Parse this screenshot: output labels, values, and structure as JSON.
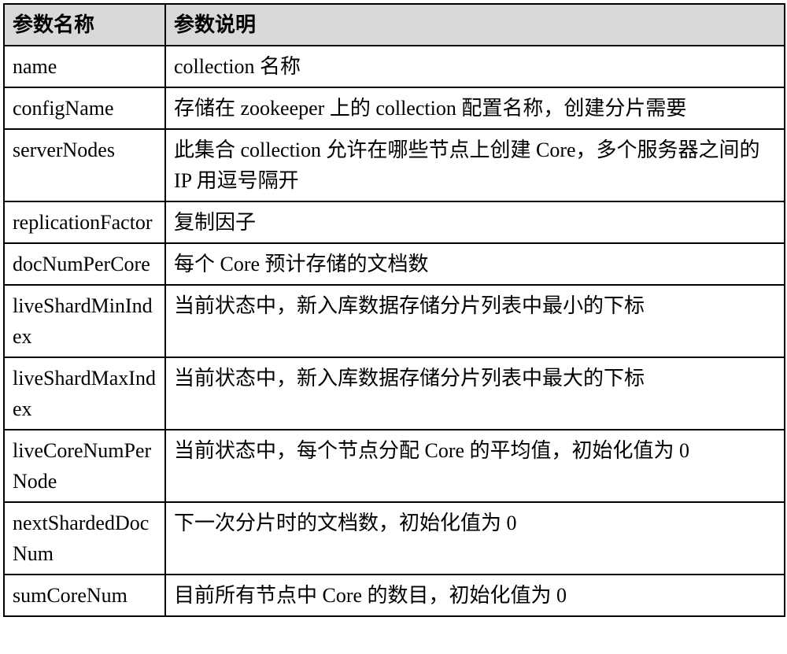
{
  "table": {
    "header": {
      "col1": "参数名称",
      "col2": "参数说明"
    },
    "rows": [
      {
        "name": "name",
        "desc": "collection 名称"
      },
      {
        "name": "configName",
        "desc": "存储在 zookeeper 上的 collection 配置名称，创建分片需要"
      },
      {
        "name": "serverNodes",
        "desc": "此集合 collection 允许在哪些节点上创建 Core，多个服务器之间的 IP 用逗号隔开"
      },
      {
        "name": "replicationFactor",
        "desc": "复制因子"
      },
      {
        "name": "docNumPerCore",
        "desc": "每个 Core 预计存储的文档数"
      },
      {
        "name": "liveShardMinIndex",
        "desc": "当前状态中，新入库数据存储分片列表中最小的下标"
      },
      {
        "name": "liveShardMaxIndex",
        "desc": "当前状态中，新入库数据存储分片列表中最大的下标"
      },
      {
        "name": "liveCoreNumPerNode",
        "desc": "当前状态中，每个节点分配 Core 的平均值，初始化值为 0"
      },
      {
        "name": "nextShardedDocNum",
        "desc": "下一次分片时的文档数，初始化值为 0"
      },
      {
        "name": "sumCoreNum",
        "desc": "目前所有节点中 Core 的数目，初始化值为 0"
      }
    ]
  }
}
